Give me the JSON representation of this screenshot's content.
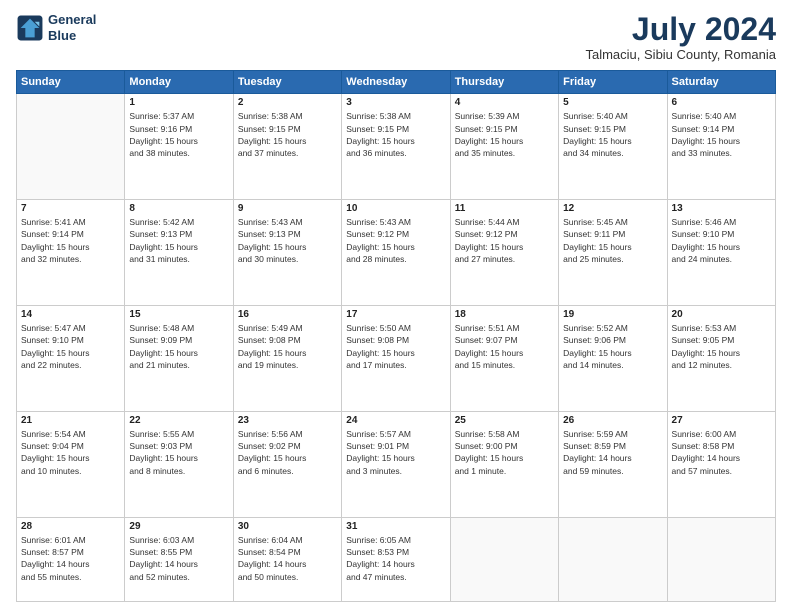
{
  "logo": {
    "line1": "General",
    "line2": "Blue"
  },
  "title": "July 2024",
  "location": "Talmaciu, Sibiu County, Romania",
  "days_header": [
    "Sunday",
    "Monday",
    "Tuesday",
    "Wednesday",
    "Thursday",
    "Friday",
    "Saturday"
  ],
  "weeks": [
    [
      {
        "day": "",
        "info": ""
      },
      {
        "day": "1",
        "info": "Sunrise: 5:37 AM\nSunset: 9:16 PM\nDaylight: 15 hours\nand 38 minutes."
      },
      {
        "day": "2",
        "info": "Sunrise: 5:38 AM\nSunset: 9:15 PM\nDaylight: 15 hours\nand 37 minutes."
      },
      {
        "day": "3",
        "info": "Sunrise: 5:38 AM\nSunset: 9:15 PM\nDaylight: 15 hours\nand 36 minutes."
      },
      {
        "day": "4",
        "info": "Sunrise: 5:39 AM\nSunset: 9:15 PM\nDaylight: 15 hours\nand 35 minutes."
      },
      {
        "day": "5",
        "info": "Sunrise: 5:40 AM\nSunset: 9:15 PM\nDaylight: 15 hours\nand 34 minutes."
      },
      {
        "day": "6",
        "info": "Sunrise: 5:40 AM\nSunset: 9:14 PM\nDaylight: 15 hours\nand 33 minutes."
      }
    ],
    [
      {
        "day": "7",
        "info": "Sunrise: 5:41 AM\nSunset: 9:14 PM\nDaylight: 15 hours\nand 32 minutes."
      },
      {
        "day": "8",
        "info": "Sunrise: 5:42 AM\nSunset: 9:13 PM\nDaylight: 15 hours\nand 31 minutes."
      },
      {
        "day": "9",
        "info": "Sunrise: 5:43 AM\nSunset: 9:13 PM\nDaylight: 15 hours\nand 30 minutes."
      },
      {
        "day": "10",
        "info": "Sunrise: 5:43 AM\nSunset: 9:12 PM\nDaylight: 15 hours\nand 28 minutes."
      },
      {
        "day": "11",
        "info": "Sunrise: 5:44 AM\nSunset: 9:12 PM\nDaylight: 15 hours\nand 27 minutes."
      },
      {
        "day": "12",
        "info": "Sunrise: 5:45 AM\nSunset: 9:11 PM\nDaylight: 15 hours\nand 25 minutes."
      },
      {
        "day": "13",
        "info": "Sunrise: 5:46 AM\nSunset: 9:10 PM\nDaylight: 15 hours\nand 24 minutes."
      }
    ],
    [
      {
        "day": "14",
        "info": "Sunrise: 5:47 AM\nSunset: 9:10 PM\nDaylight: 15 hours\nand 22 minutes."
      },
      {
        "day": "15",
        "info": "Sunrise: 5:48 AM\nSunset: 9:09 PM\nDaylight: 15 hours\nand 21 minutes."
      },
      {
        "day": "16",
        "info": "Sunrise: 5:49 AM\nSunset: 9:08 PM\nDaylight: 15 hours\nand 19 minutes."
      },
      {
        "day": "17",
        "info": "Sunrise: 5:50 AM\nSunset: 9:08 PM\nDaylight: 15 hours\nand 17 minutes."
      },
      {
        "day": "18",
        "info": "Sunrise: 5:51 AM\nSunset: 9:07 PM\nDaylight: 15 hours\nand 15 minutes."
      },
      {
        "day": "19",
        "info": "Sunrise: 5:52 AM\nSunset: 9:06 PM\nDaylight: 15 hours\nand 14 minutes."
      },
      {
        "day": "20",
        "info": "Sunrise: 5:53 AM\nSunset: 9:05 PM\nDaylight: 15 hours\nand 12 minutes."
      }
    ],
    [
      {
        "day": "21",
        "info": "Sunrise: 5:54 AM\nSunset: 9:04 PM\nDaylight: 15 hours\nand 10 minutes."
      },
      {
        "day": "22",
        "info": "Sunrise: 5:55 AM\nSunset: 9:03 PM\nDaylight: 15 hours\nand 8 minutes."
      },
      {
        "day": "23",
        "info": "Sunrise: 5:56 AM\nSunset: 9:02 PM\nDaylight: 15 hours\nand 6 minutes."
      },
      {
        "day": "24",
        "info": "Sunrise: 5:57 AM\nSunset: 9:01 PM\nDaylight: 15 hours\nand 3 minutes."
      },
      {
        "day": "25",
        "info": "Sunrise: 5:58 AM\nSunset: 9:00 PM\nDaylight: 15 hours\nand 1 minute."
      },
      {
        "day": "26",
        "info": "Sunrise: 5:59 AM\nSunset: 8:59 PM\nDaylight: 14 hours\nand 59 minutes."
      },
      {
        "day": "27",
        "info": "Sunrise: 6:00 AM\nSunset: 8:58 PM\nDaylight: 14 hours\nand 57 minutes."
      }
    ],
    [
      {
        "day": "28",
        "info": "Sunrise: 6:01 AM\nSunset: 8:57 PM\nDaylight: 14 hours\nand 55 minutes."
      },
      {
        "day": "29",
        "info": "Sunrise: 6:03 AM\nSunset: 8:55 PM\nDaylight: 14 hours\nand 52 minutes."
      },
      {
        "day": "30",
        "info": "Sunrise: 6:04 AM\nSunset: 8:54 PM\nDaylight: 14 hours\nand 50 minutes."
      },
      {
        "day": "31",
        "info": "Sunrise: 6:05 AM\nSunset: 8:53 PM\nDaylight: 14 hours\nand 47 minutes."
      },
      {
        "day": "",
        "info": ""
      },
      {
        "day": "",
        "info": ""
      },
      {
        "day": "",
        "info": ""
      }
    ]
  ]
}
